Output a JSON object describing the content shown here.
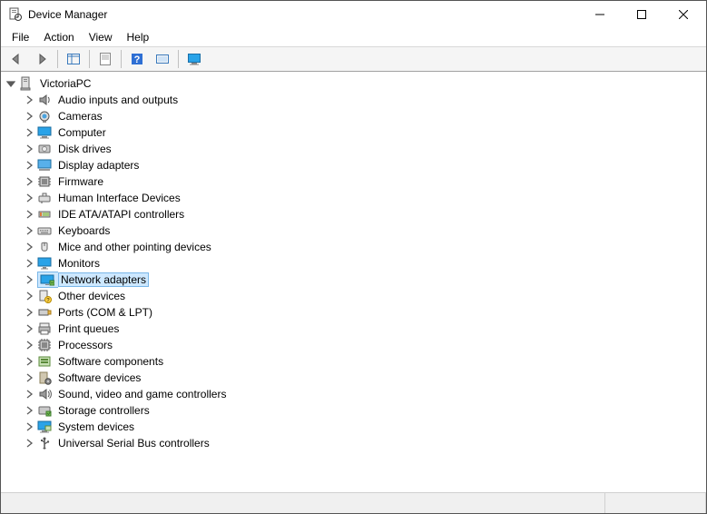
{
  "window": {
    "title": "Device Manager"
  },
  "menu": {
    "file": "File",
    "action": "Action",
    "view": "View",
    "help": "Help"
  },
  "tree": {
    "root": {
      "label": "VictoriaPC",
      "expanded": true
    },
    "categories": [
      {
        "id": "audio",
        "label": "Audio inputs and outputs"
      },
      {
        "id": "cameras",
        "label": "Cameras"
      },
      {
        "id": "computer",
        "label": "Computer"
      },
      {
        "id": "disk",
        "label": "Disk drives"
      },
      {
        "id": "display",
        "label": "Display adapters"
      },
      {
        "id": "firmware",
        "label": "Firmware"
      },
      {
        "id": "hid",
        "label": "Human Interface Devices"
      },
      {
        "id": "ide",
        "label": "IDE ATA/ATAPI controllers"
      },
      {
        "id": "keyboards",
        "label": "Keyboards"
      },
      {
        "id": "mice",
        "label": "Mice and other pointing devices"
      },
      {
        "id": "monitors",
        "label": "Monitors"
      },
      {
        "id": "network",
        "label": "Network adapters",
        "selected": true
      },
      {
        "id": "other",
        "label": "Other devices"
      },
      {
        "id": "ports",
        "label": "Ports (COM & LPT)"
      },
      {
        "id": "print",
        "label": "Print queues"
      },
      {
        "id": "processors",
        "label": "Processors"
      },
      {
        "id": "swcomp",
        "label": "Software components"
      },
      {
        "id": "swdev",
        "label": "Software devices"
      },
      {
        "id": "sound",
        "label": "Sound, video and game controllers"
      },
      {
        "id": "storage",
        "label": "Storage controllers"
      },
      {
        "id": "system",
        "label": "System devices"
      },
      {
        "id": "usb",
        "label": "Universal Serial Bus controllers"
      }
    ]
  }
}
